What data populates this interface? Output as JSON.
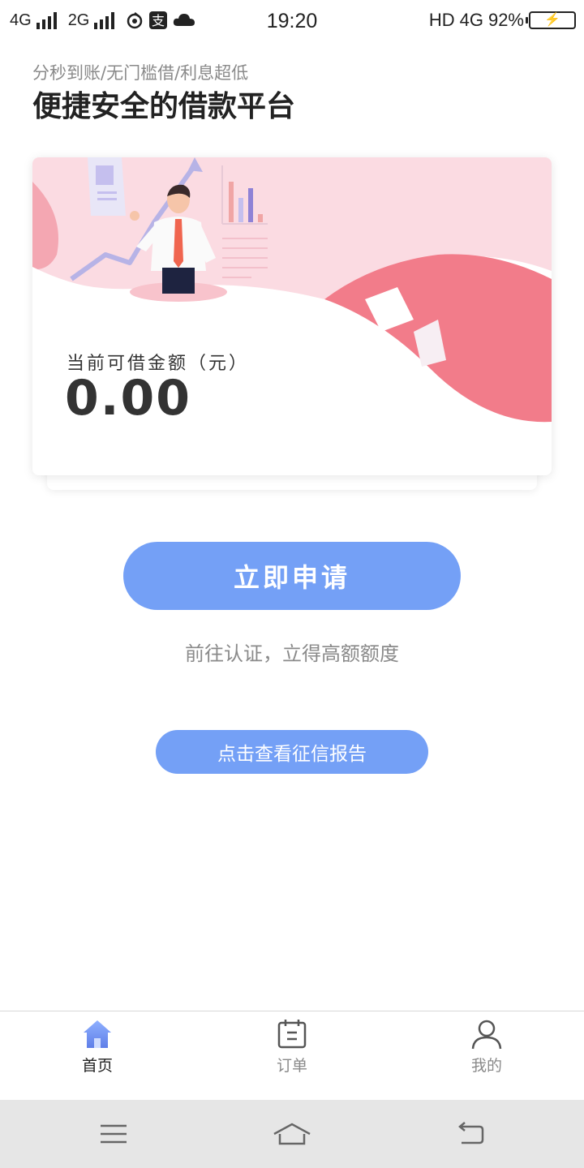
{
  "status_bar": {
    "network1": "4G",
    "network2": "2G",
    "time": "19:20",
    "hd": "HD",
    "network3": "4G",
    "battery": "92%"
  },
  "header": {
    "subtitle": "分秒到账/无门槛借/利息超低",
    "title": "便捷安全的借款平台"
  },
  "card": {
    "amount_label": "当前可借金额（元）",
    "amount_value": "0.00"
  },
  "actions": {
    "apply_label": "立即申请",
    "hint": "前往认证，立得高额额度",
    "credit_report_label": "点击查看征信报告"
  },
  "tab_bar": {
    "items": [
      {
        "label": "首页",
        "icon": "home-icon",
        "active": true
      },
      {
        "label": "订单",
        "icon": "order-icon",
        "active": false
      },
      {
        "label": "我的",
        "icon": "user-icon",
        "active": false
      }
    ]
  },
  "system_nav": {
    "icons": [
      "menu-icon",
      "home-icon",
      "back-icon"
    ]
  },
  "colors": {
    "accent": "#74a0f6",
    "banner_pink": "#fbdbe2",
    "banner_red": "#f27c8a",
    "text_dark": "#222222",
    "text_muted": "#8a8a8a"
  }
}
